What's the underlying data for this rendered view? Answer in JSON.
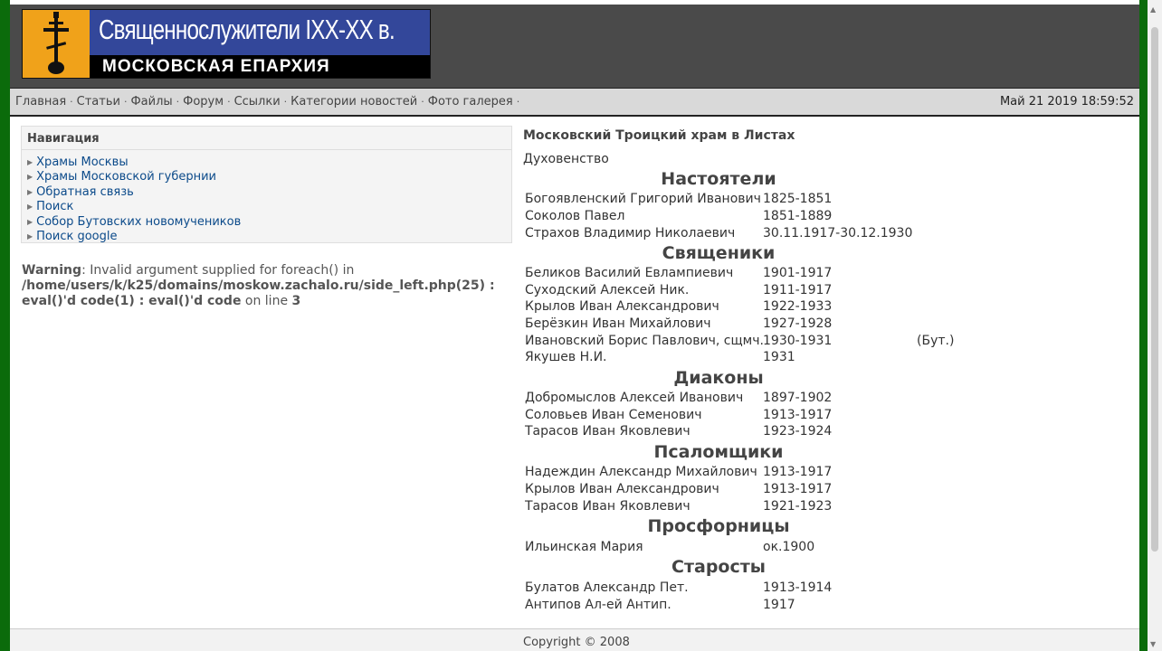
{
  "header": {
    "logo_title": "Священнослужители IXX-XX в.",
    "logo_subtitle": "МОСКОВСКАЯ ЕПАРХИЯ"
  },
  "nav": {
    "links": [
      "Главная",
      "Статьи",
      "Файлы",
      "Форум",
      "Ссылки",
      "Категории новостей",
      "Фото галерея"
    ],
    "separator": "·",
    "datetime": "Май 21 2019 18:59:52"
  },
  "sidebar": {
    "title": "Навигация",
    "items": [
      "Храмы Москвы",
      "Храмы Московской губернии",
      "Обратная связь",
      "Поиск",
      "Собор Бутовских новомучеников",
      "Поиск google"
    ]
  },
  "warning": {
    "label": "Warning",
    "message": ": Invalid argument supplied for foreach() in",
    "path": "/home/users/k/k25/domains/moskow.zachalo.ru/side_left.php(25) : eval()'d code(1) : eval()'d code",
    "on_line": " on line ",
    "line": "3"
  },
  "content": {
    "title": "Московский Троицкий храм в Листах",
    "subtitle": "Духовенство",
    "sections": [
      {
        "title": "Настоятели",
        "rows": [
          {
            "name": "Богоявленский Григорий Иванович",
            "years": "1825-1851"
          },
          {
            "name": "Соколов Павел",
            "years": "1851-1889"
          },
          {
            "name": "Страхов Владимир Николаевич",
            "years": "30.11.1917-30.12.1930"
          }
        ]
      },
      {
        "title": "Священики",
        "rows": [
          {
            "name": "Беликов Василий Евлампиевич",
            "years": "1901-1917"
          },
          {
            "name": "Суходский Алексей Ник.",
            "years": "1911-1917"
          },
          {
            "name": "Крылов Иван Александрович",
            "years": "1922-1933"
          },
          {
            "name": "Берёзкин Иван Михайлович",
            "years": "1927-1928"
          },
          {
            "name": "Ивановский Борис Павлович, сщмч.",
            "years": "1930-1931",
            "note": "(Бут.)"
          },
          {
            "name": "Якушев Н.И.",
            "years": "1931"
          }
        ]
      },
      {
        "title": "Диаконы",
        "rows": [
          {
            "name": "Добромыслов Алексей Иванович",
            "years": "1897-1902"
          },
          {
            "name": "Соловьев Иван Семенович",
            "years": "1913-1917"
          },
          {
            "name": "Тарасов Иван Яковлевич",
            "years": "1923-1924"
          }
        ]
      },
      {
        "title": "Псаломщики",
        "rows": [
          {
            "name": "Надеждин Александр Михайлович",
            "years": "1913-1917"
          },
          {
            "name": "Крылов Иван Александрович",
            "years": "1913-1917"
          },
          {
            "name": "Тарасов Иван Яковлевич",
            "years": "1921-1923"
          }
        ]
      },
      {
        "title": "Просфорницы",
        "rows": [
          {
            "name": "Ильинская Мария",
            "years": "ок.1900"
          }
        ]
      },
      {
        "title": "Старосты",
        "rows": [
          {
            "name": "Булатов Александр Пет.",
            "years": "1913-1914"
          },
          {
            "name": "Антипов Ал-ей Антип.",
            "years": "1917"
          }
        ]
      }
    ]
  },
  "footer": {
    "copyright": "Copyright © 2008"
  }
}
